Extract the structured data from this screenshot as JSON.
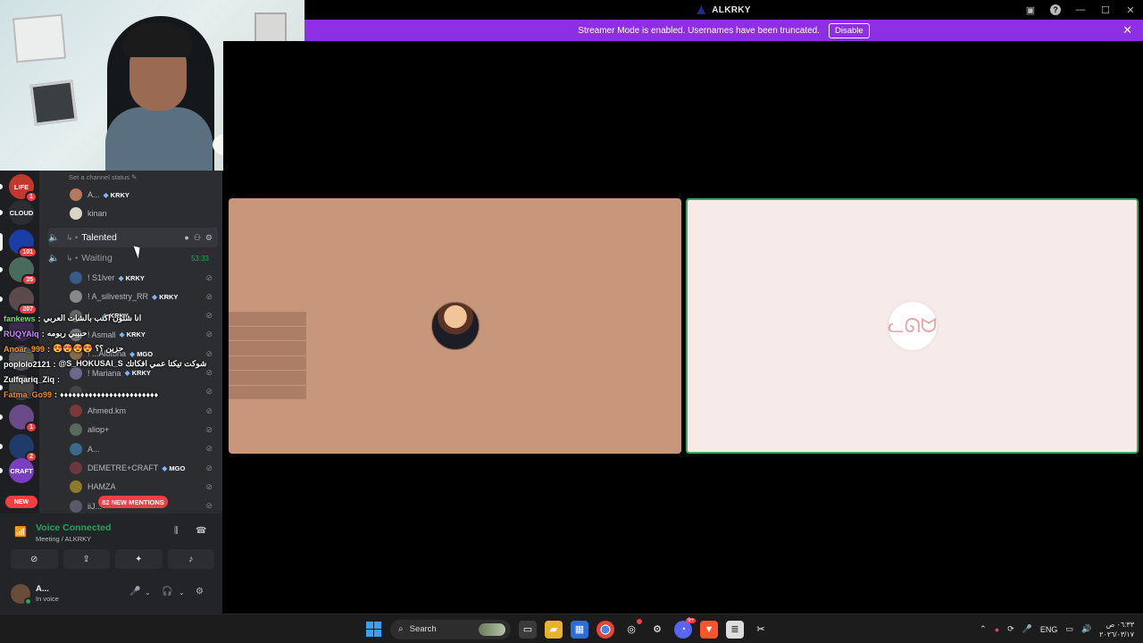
{
  "window": {
    "title": "ALKRKY"
  },
  "streamer_banner": {
    "message": "Streamer Mode is enabled. Usernames have been truncated.",
    "disable_label": "Disable",
    "close_glyph": "✕"
  },
  "servers": [
    {
      "label": "LIFE",
      "badge": "1",
      "color": "#c0392b",
      "active": false
    },
    {
      "label": "CLOUD",
      "badge": "",
      "color": "#2b2d31",
      "active": false
    },
    {
      "label": "",
      "badge": "101",
      "color": "#1b3ea6",
      "active": true
    },
    {
      "label": "",
      "badge": "35",
      "color": "#4a6b5c",
      "active": false
    },
    {
      "label": "",
      "badge": "207",
      "color": "#5a4a4a",
      "active": false
    },
    {
      "label": "",
      "badge": "",
      "color": "#3b2b4a",
      "active": false
    },
    {
      "label": "",
      "badge": "",
      "color": "#555",
      "active": false
    },
    {
      "label": "",
      "badge": "",
      "color": "#444",
      "active": false
    },
    {
      "label": "",
      "badge": "1",
      "color": "#6b4a8a",
      "active": false
    },
    {
      "label": "",
      "badge": "2",
      "color": "#1f3a6b",
      "active": false
    },
    {
      "label": "CRAFT",
      "badge": "",
      "color": "#7a3fc0",
      "active": false
    }
  ],
  "server_new_badge": "NEW",
  "channel_sidebar": {
    "status_placeholder": "Set a channel status ✎",
    "top_users": [
      {
        "name": "A...",
        "tag": "KRKY",
        "color": "#b57a5e"
      },
      {
        "name": "kinan",
        "tag": "",
        "color": "#d9d2c5"
      }
    ],
    "channels": [
      {
        "name": "Talented",
        "timer": "",
        "active": true
      },
      {
        "name": "Waiting",
        "timer": "53:33",
        "active": false
      }
    ],
    "waiting_users": [
      {
        "name": "! S1lver",
        "tag": "KRKY",
        "color": "#3a5a8a"
      },
      {
        "name": "! A_silivestry_RR",
        "tag": "KRKY",
        "color": "#888"
      },
      {
        "name": "! ...",
        "tag": "KRKY",
        "color": "#666"
      },
      {
        "name": "! Asmall",
        "tag": "KRKY",
        "color": "#777"
      },
      {
        "name": "! ...Alotoha",
        "tag": "MGO",
        "color": "#8a6a4a"
      },
      {
        "name": "! Mariana",
        "tag": "KRKY",
        "color": "#6a6a8a"
      },
      {
        "name": "...",
        "tag": "",
        "color": "#444"
      },
      {
        "name": "Ahmed.km",
        "tag": "",
        "color": "#7a3a3a"
      },
      {
        "name": "aliop+",
        "tag": "",
        "color": "#5a6a5a"
      },
      {
        "name": "A...",
        "tag": "",
        "color": "#3a6a8a"
      },
      {
        "name": "DEMETRE+CRAFT",
        "tag": "MGO",
        "color": "#6a3a3a"
      },
      {
        "name": "HAMZA",
        "tag": "",
        "color": "#8a7a2a"
      },
      {
        "name": "iiJ...",
        "tag": "",
        "color": "#5a5a6a"
      }
    ],
    "mentions_label": "82 NEW MENTIONS"
  },
  "chat_overlay": [
    {
      "user": "fankews",
      "color": "#6fe36f",
      "text": "انا شلون اكتب بالشات العربي"
    },
    {
      "user": "RUQYAlq",
      "color": "#c68cff",
      "text": "حبيبي ربومه"
    },
    {
      "user": "Anoar_999",
      "color": "#f0a020",
      "text": "😍😍😍😍 حزين ؟؟"
    },
    {
      "user": "poplolo2121",
      "color": "#ffffff",
      "text": "@S_HOKUSAI_S شوكت تيكتا عمي افكاتك"
    },
    {
      "user": "Zulfqariq_Ziq",
      "color": "#ffffff",
      "text": ""
    },
    {
      "user": "Fatma_Go99",
      "color": "#f28a2e",
      "text": "♦♦♦♦♦♦♦♦♦♦♦♦♦♦♦♦♦♦♦♦♦♦♦♦"
    }
  ],
  "voice_panel": {
    "title": "Voice Connected",
    "subtitle": "Meeting / ALKRKY"
  },
  "user_panel": {
    "name": "A...",
    "status": "In voice"
  },
  "stage": {
    "tile1_bg": "#c8967a",
    "tile2_bg": "#f7ebea",
    "speaking_border": "#3ba55d"
  },
  "taskbar": {
    "search_label": "Search",
    "language": "ENG",
    "time": "٠٦:٣٣ ص",
    "date": "٢٠٢٦/٠٣/١٧",
    "discord_badge": "9+"
  }
}
